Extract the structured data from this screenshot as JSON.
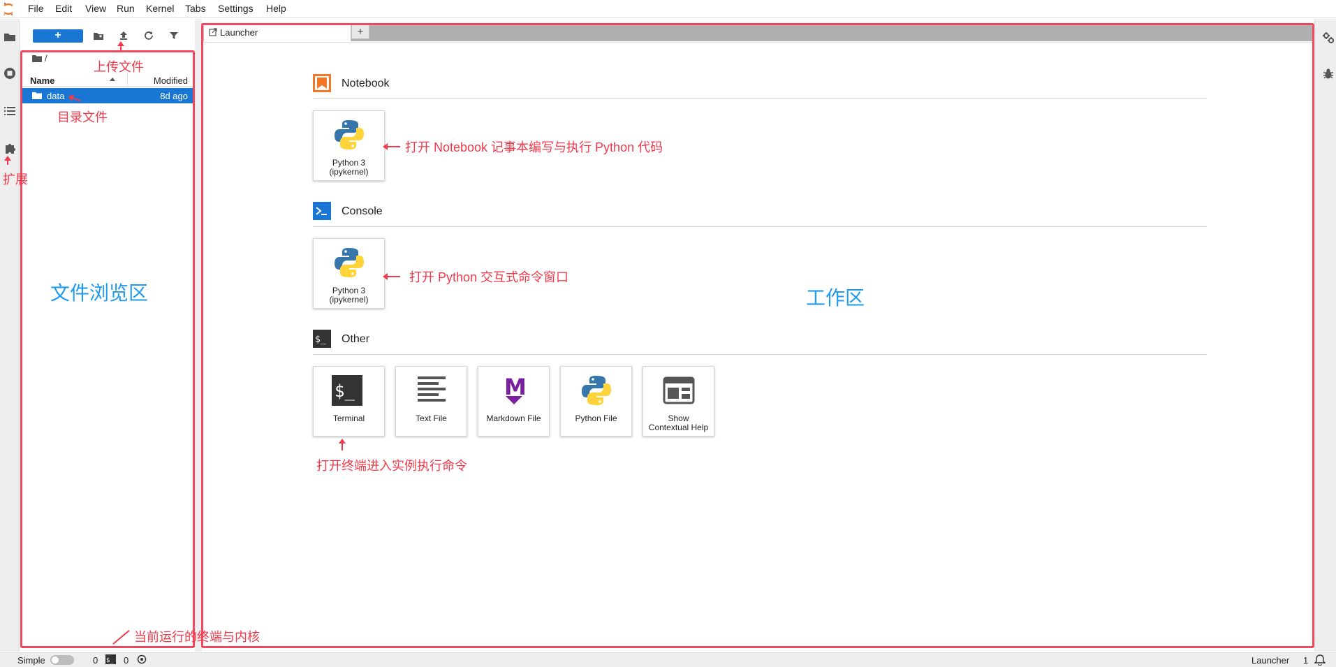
{
  "menubar": {
    "items": [
      "File",
      "Edit",
      "View",
      "Run",
      "Kernel",
      "Tabs",
      "Settings",
      "Help"
    ]
  },
  "file_browser": {
    "new_button": "+",
    "breadcrumb": "/",
    "columns": {
      "name": "Name",
      "modified": "Modified"
    },
    "rows": [
      {
        "name": "data",
        "modified": "8d ago"
      }
    ]
  },
  "tabs": {
    "active_label": "Launcher",
    "add_label": "+"
  },
  "launcher": {
    "sections": [
      {
        "title": "Notebook",
        "cards": [
          {
            "label_line1": "Python 3",
            "label_line2": "(ipykernel)"
          }
        ]
      },
      {
        "title": "Console",
        "cards": [
          {
            "label_line1": "Python 3",
            "label_line2": "(ipykernel)"
          }
        ]
      },
      {
        "title": "Other",
        "cards": [
          {
            "label_line1": "Terminal",
            "label_line2": ""
          },
          {
            "label_line1": "Text File",
            "label_line2": ""
          },
          {
            "label_line1": "Markdown File",
            "label_line2": ""
          },
          {
            "label_line1": "Python File",
            "label_line2": ""
          },
          {
            "label_line1": "Show",
            "label_line2": "Contextual Help"
          }
        ]
      }
    ]
  },
  "statusbar": {
    "mode_label": "Simple",
    "terminals_count": "0",
    "kernels_count": "0",
    "right_label": "Launcher",
    "right_count": "1"
  },
  "annotations": {
    "upload_files": "上传文件",
    "directory_files": "目录文件",
    "extensions": "扩展",
    "file_browser_area": "文件浏览区",
    "workspace_area": "工作区",
    "notebook_hint": "打开 Notebook 记事本编写与执行 Python 代码",
    "console_hint": "打开 Python 交互式命令窗口",
    "terminal_hint": "打开终端进入实例执行命令",
    "running_hint": "当前运行的终端与内核"
  },
  "colors": {
    "accent": "#1976d2",
    "annotation_red": "#f03a4b",
    "annotation_blue": "#1e9bf0",
    "notebook_orange": "#f37726"
  }
}
